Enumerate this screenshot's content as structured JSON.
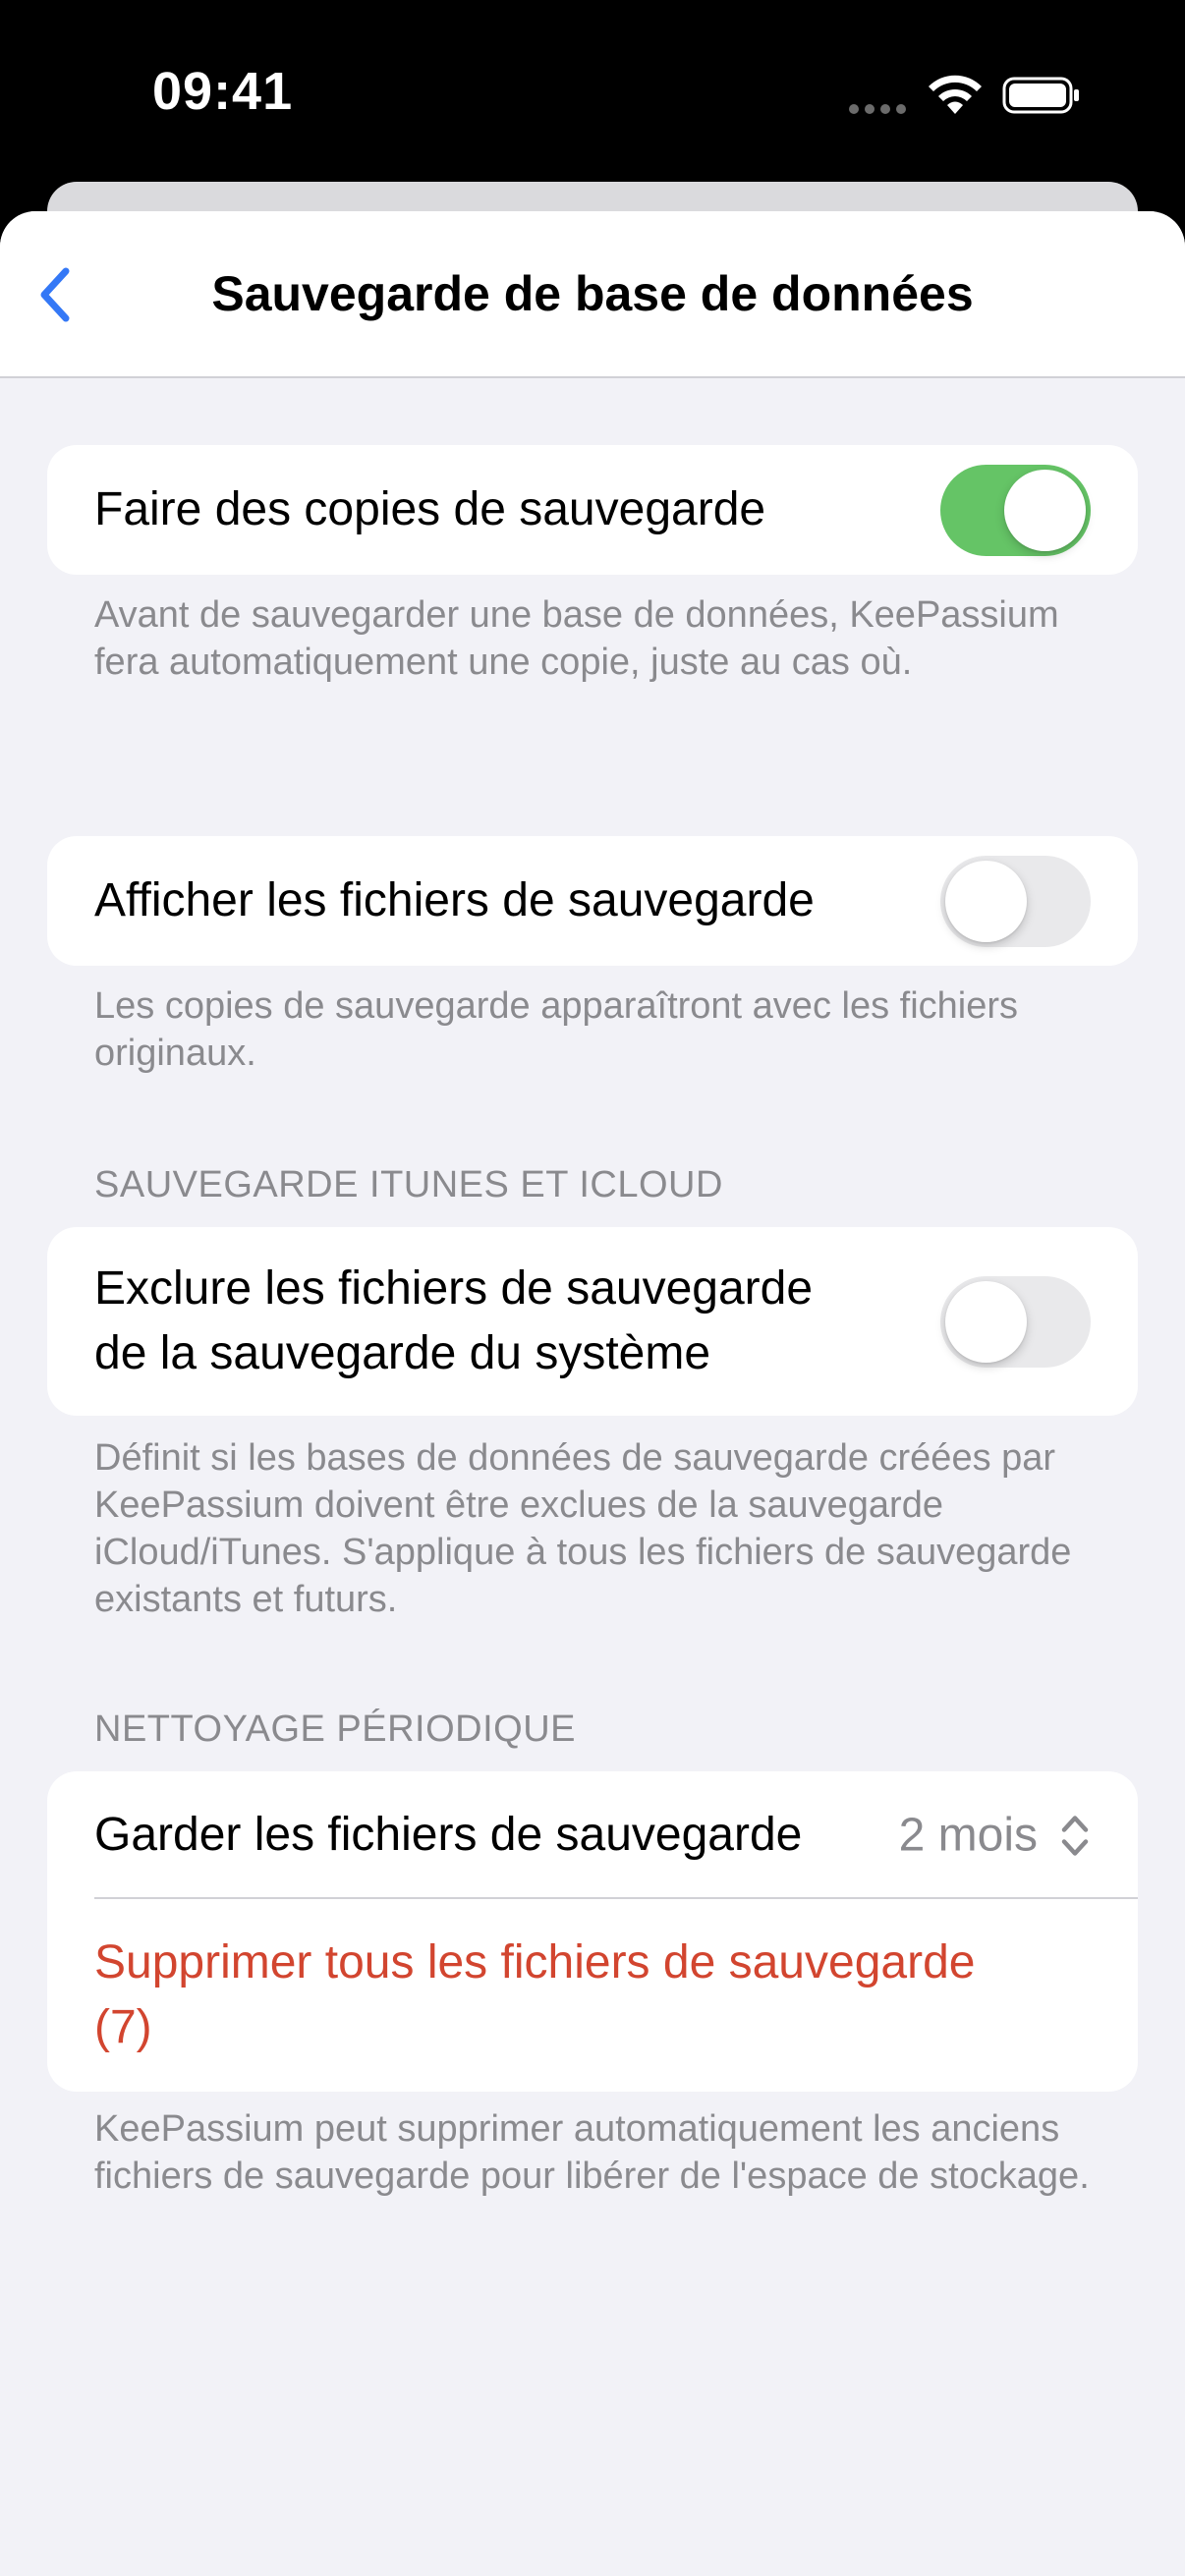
{
  "status_bar": {
    "time": "09:41"
  },
  "nav": {
    "title": "Sauvegarde de base de données"
  },
  "sections": {
    "backup": {
      "toggle_label": "Faire des copies de sauvegarde",
      "toggle_on": true,
      "footer": "Avant de sauvegarder une base de données, KeePassium fera automatiquement une copie, juste au cas où."
    },
    "show_files": {
      "toggle_label": "Afficher les fichiers de sauvegarde",
      "toggle_on": false,
      "footer": "Les copies de sauvegarde apparaîtront avec les fichiers originaux."
    },
    "itunes_icloud": {
      "header": "SAUVEGARDE ITUNES ET ICLOUD",
      "toggle_label_line1": "Exclure les fichiers de sauvegarde",
      "toggle_label_line2": "de la sauvegarde du système",
      "toggle_on": false,
      "footer": "Définit si les bases de données de sauvegarde créées par KeePassium doivent être exclues de la sauvegarde iCloud/iTunes. S'applique à tous les fichiers de sauvegarde existants et futurs."
    },
    "cleanup": {
      "header": "NETTOYAGE PÉRIODIQUE",
      "keep_label": "Garder les fichiers de sauvegarde",
      "keep_value": "2 mois",
      "delete_line1": "Supprimer tous les fichiers de sauvegarde",
      "delete_line2": "(7)",
      "footer": "KeePassium peut supprimer automatiquement les anciens fichiers de sauvegarde pour libérer de l'espace de stockage."
    }
  },
  "icons": {
    "back": "chevron-left-icon",
    "updown": "chevron-up-down-icon",
    "wifi": "wifi-icon",
    "battery": "battery-icon",
    "signal": "signal-dots-icon"
  },
  "colors": {
    "accent": "#3478f6",
    "toggle_on": "#65c466",
    "destructive": "#d2452f",
    "secondary_text": "#8a8a8e",
    "grouped_background": "#f2f2f7"
  }
}
